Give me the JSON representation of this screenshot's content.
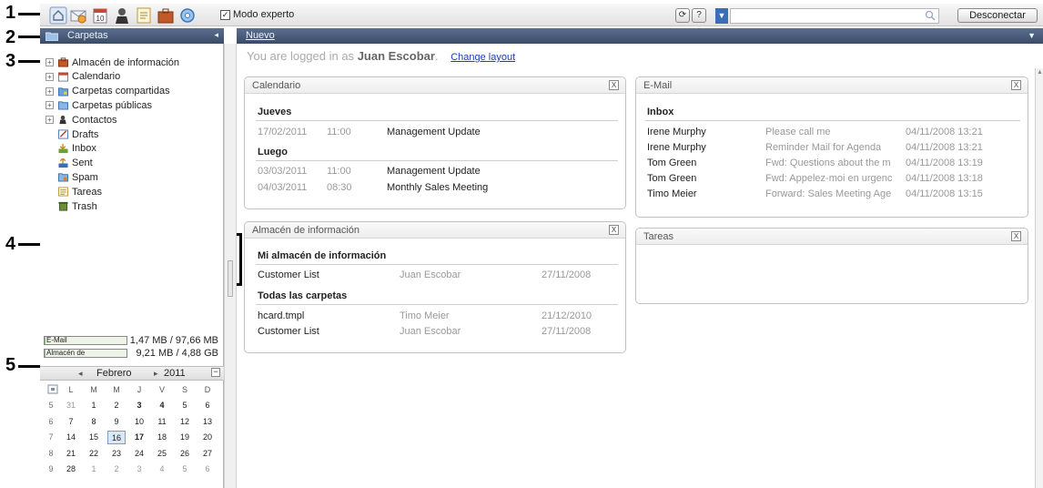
{
  "callouts": [
    "1",
    "2",
    "3",
    "4",
    "5"
  ],
  "toolbar": {
    "icons": [
      "portal-icon",
      "mail-icon",
      "calendar-icon",
      "contacts-icon",
      "tasks-icon",
      "infostore-icon",
      "settings-icon"
    ],
    "expert_mode_label": "Modo experto",
    "expert_mode_checked": true,
    "refresh_icon": "refresh-icon",
    "help_label": "?",
    "search_placeholder": "",
    "logout_label": "Desconectar"
  },
  "sidebar": {
    "title": "Carpetas",
    "folders": [
      {
        "label": "Almacén de información",
        "icon": "infostore-icon",
        "expandable": true
      },
      {
        "label": "Calendario",
        "icon": "calendar-icon",
        "expandable": true
      },
      {
        "label": "Carpetas compartidas",
        "icon": "shared-folder-icon",
        "expandable": true
      },
      {
        "label": "Carpetas públicas",
        "icon": "public-folder-icon",
        "expandable": true
      },
      {
        "label": "Contactos",
        "icon": "contacts-icon",
        "expandable": true
      },
      {
        "label": "Drafts",
        "icon": "drafts-icon",
        "expandable": false
      },
      {
        "label": "Inbox",
        "icon": "inbox-icon",
        "expandable": false
      },
      {
        "label": "Sent",
        "icon": "sent-icon",
        "expandable": false
      },
      {
        "label": "Spam",
        "icon": "spam-icon",
        "expandable": false
      },
      {
        "label": "Tareas",
        "icon": "tasks-icon",
        "expandable": false
      },
      {
        "label": "Trash",
        "icon": "trash-icon",
        "expandable": false
      }
    ],
    "quota": [
      {
        "label": "E-Mail",
        "value": "1,47 MB / 97,66 MB",
        "fill": 0.015
      },
      {
        "label": "Almacén de",
        "value": "9,21 MB / 4,88 GB",
        "fill": 0.002
      }
    ]
  },
  "mini_calendar": {
    "month": "Febrero",
    "year": "2011",
    "prev": "◂",
    "next": "▸",
    "collapse": "−",
    "weekdays": [
      "L",
      "M",
      "M",
      "J",
      "V",
      "S",
      "D"
    ],
    "weeks": [
      {
        "wk": "5",
        "days": [
          "31",
          "1",
          "2",
          "3",
          "4",
          "5",
          "6"
        ]
      },
      {
        "wk": "6",
        "days": [
          "7",
          "8",
          "9",
          "10",
          "11",
          "12",
          "13"
        ]
      },
      {
        "wk": "7",
        "days": [
          "14",
          "15",
          "16",
          "17",
          "18",
          "19",
          "20"
        ]
      },
      {
        "wk": "8",
        "days": [
          "21",
          "22",
          "23",
          "24",
          "25",
          "26",
          "27"
        ]
      },
      {
        "wk": "9",
        "days": [
          "28",
          "1",
          "2",
          "3",
          "4",
          "5",
          "6"
        ]
      }
    ],
    "today": "16",
    "bold_days": [
      "3",
      "4",
      "17"
    ]
  },
  "main": {
    "tab_label": "Nuevo",
    "welcome_prefix": "You are logged in as",
    "user_name": "Juan Escobar",
    "welcome_suffix": ".",
    "change_layout": "Change layout",
    "close_glyph": "X"
  },
  "calendar_widget": {
    "title": "Calendario",
    "sections": [
      {
        "heading": "Jueves",
        "rows": [
          {
            "date": "17/02/2011",
            "time": "11:00",
            "subject": "Management Update"
          }
        ]
      },
      {
        "heading": "Luego",
        "rows": [
          {
            "date": "03/03/2011",
            "time": "11:00",
            "subject": "Management Update"
          },
          {
            "date": "04/03/2011",
            "time": "08:30",
            "subject": "Monthly Sales Meeting"
          }
        ]
      }
    ]
  },
  "infostore_widget": {
    "title": "Almacén de información",
    "sections": [
      {
        "heading": "Mi almacén de información",
        "rows": [
          {
            "name": "Customer List",
            "owner": "Juan Escobar",
            "date": "27/11/2008"
          }
        ]
      },
      {
        "heading": "Todas las carpetas",
        "rows": [
          {
            "name": "hcard.tmpl",
            "owner": "Timo Meier",
            "date": "21/12/2010"
          },
          {
            "name": "Customer List",
            "owner": "Juan Escobar",
            "date": "27/11/2008"
          }
        ]
      }
    ]
  },
  "email_widget": {
    "title": "E-Mail",
    "folder": "Inbox",
    "rows": [
      {
        "from": "Irene Murphy",
        "subject": "Please call me",
        "date": "04/11/2008 13:21"
      },
      {
        "from": "Irene Murphy",
        "subject": "Reminder Mail for Agenda",
        "date": "04/11/2008 13:21"
      },
      {
        "from": "Tom Green",
        "subject": "Fwd: Questions about the m",
        "date": "04/11/2008 13:19"
      },
      {
        "from": "Tom Green",
        "subject": "Fwd: Appelez-moi en urgenc",
        "date": "04/11/2008 13:18"
      },
      {
        "from": "Timo Meier",
        "subject": "Forward: Sales Meeting Age",
        "date": "04/11/2008 13:15"
      }
    ]
  },
  "tasks_widget": {
    "title": "Tareas"
  },
  "colors": {
    "header_bar": "#3b4c68",
    "link": "#1a3fb8",
    "today_bg": "#dbe6f7"
  }
}
